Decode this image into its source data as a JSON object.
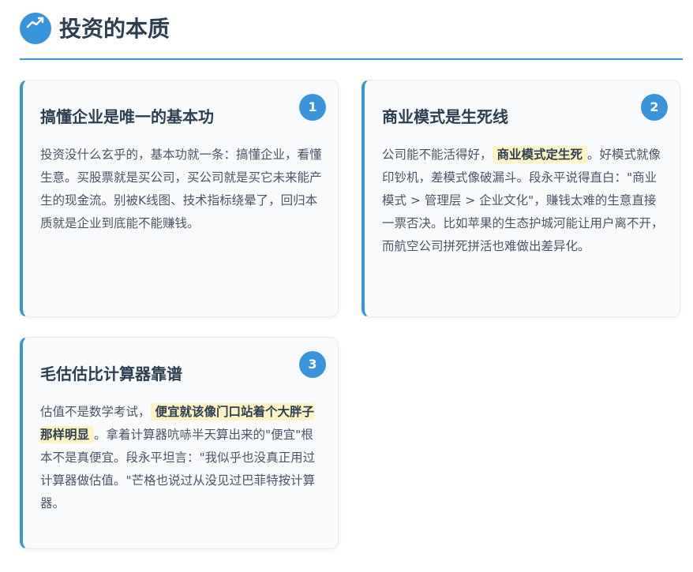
{
  "header": {
    "title": "投资的本质",
    "icon": "chart-icon",
    "accent_color": "#3a94dc"
  },
  "cards": [
    {
      "number": "1",
      "title": "搞懂企业是唯一的基本功",
      "text": "投资没什么玄乎的，基本功就一条：搞懂企业，看懂生意。买股票就是买公司，买公司就是买它未来能产生的现金流。别被K线图、技术指标绕晕了，回归本质就是企业到底能不能赚钱。"
    },
    {
      "number": "2",
      "title": "商业模式是生死线",
      "text_before": "公司能不能活得好，",
      "highlight": "商业模式定生死",
      "text_after": "。好模式就像印钞机，差模式像破漏斗。段永平说得直白：\"商业模式 > 管理层 > 企业文化\"，赚钱太难的生意直接一票否决。比如苹果的生态护城河能让用户离不开，而航空公司拼死拼活也难做出差异化。"
    },
    {
      "number": "3",
      "title": "毛估估比计算器靠谱",
      "text_before": "估值不是数学考试，",
      "highlight": "便宜就该像门口站着个大胖子那样明显",
      "text_after": "。拿着计算器吭哧半天算出来的\"便宜\"根本不是真便宜。段永平坦言：\"我似乎也没真正用过计算器做估值。\"芒格也说过从没见过巴菲特按计算器。"
    }
  ],
  "colors": {
    "highlight_bg": "#fdf3c4",
    "card_bg": "#f8fafc",
    "title_text": "#2c3e50",
    "body_text": "#4a5568"
  }
}
